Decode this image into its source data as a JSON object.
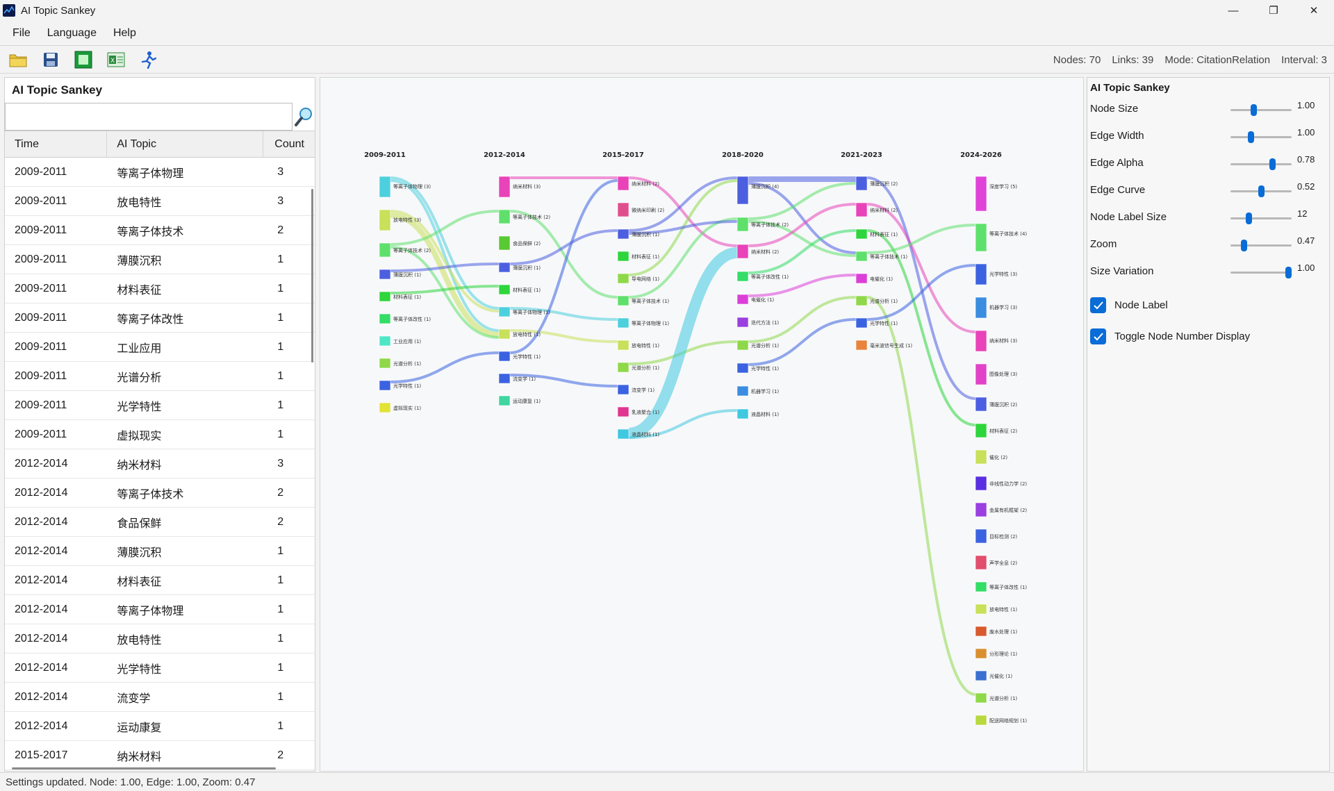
{
  "window": {
    "title": "AI Topic Sankey"
  },
  "menu": [
    "File",
    "Language",
    "Help"
  ],
  "toolbar": {
    "icons": [
      "open-folder-icon",
      "save-icon",
      "export-image-icon",
      "export-excel-icon",
      "run-icon"
    ]
  },
  "status": {
    "nodes": "Nodes: 70",
    "links": "Links: 39",
    "mode": "Mode: CitationRelation",
    "interval": "Interval: 3"
  },
  "left_panel": {
    "title": "AI Topic Sankey",
    "search_value": "",
    "headers": [
      "Time",
      "AI Topic",
      "Count"
    ],
    "rows": [
      [
        "2009-2011",
        "等离子体物理",
        "3"
      ],
      [
        "2009-2011",
        "放电特性",
        "3"
      ],
      [
        "2009-2011",
        "等离子体技术",
        "2"
      ],
      [
        "2009-2011",
        "薄膜沉积",
        "1"
      ],
      [
        "2009-2011",
        "材料表征",
        "1"
      ],
      [
        "2009-2011",
        "等离子体改性",
        "1"
      ],
      [
        "2009-2011",
        "工业应用",
        "1"
      ],
      [
        "2009-2011",
        "光谱分析",
        "1"
      ],
      [
        "2009-2011",
        "光学特性",
        "1"
      ],
      [
        "2009-2011",
        "虚拟现实",
        "1"
      ],
      [
        "2012-2014",
        "纳米材料",
        "3"
      ],
      [
        "2012-2014",
        "等离子体技术",
        "2"
      ],
      [
        "2012-2014",
        "食品保鲜",
        "2"
      ],
      [
        "2012-2014",
        "薄膜沉积",
        "1"
      ],
      [
        "2012-2014",
        "材料表征",
        "1"
      ],
      [
        "2012-2014",
        "等离子体物理",
        "1"
      ],
      [
        "2012-2014",
        "放电特性",
        "1"
      ],
      [
        "2012-2014",
        "光学特性",
        "1"
      ],
      [
        "2012-2014",
        "流变学",
        "1"
      ],
      [
        "2012-2014",
        "运动康复",
        "1"
      ],
      [
        "2015-2017",
        "纳米材料",
        "2"
      ]
    ]
  },
  "right_panel": {
    "title": "AI Topic Sankey",
    "sliders": [
      {
        "label": "Node Size",
        "value": "1.00",
        "pos": 0.38
      },
      {
        "label": "Edge Width",
        "value": "1.00",
        "pos": 0.33
      },
      {
        "label": "Edge Alpha",
        "value": "0.78",
        "pos": 0.68
      },
      {
        "label": "Edge Curve",
        "value": "0.52",
        "pos": 0.5
      },
      {
        "label": "Node Label Size",
        "value": "12",
        "pos": 0.3
      },
      {
        "label": "Zoom",
        "value": "0.47",
        "pos": 0.22
      },
      {
        "label": "Size Variation",
        "value": "1.00",
        "pos": 0.94
      }
    ],
    "checks": [
      {
        "label": "Node Label",
        "checked": true
      },
      {
        "label": "Toggle Node Number Display",
        "checked": true
      }
    ]
  },
  "sankey": {
    "periods": [
      "2009-2011",
      "2012-2014",
      "2015-2017",
      "2018-2020",
      "2021-2023",
      "2024-2026"
    ],
    "columns": [
      [
        {
          "label": "等离子体物理 (3)",
          "color": "#4dd0dd",
          "n": 3
        },
        {
          "label": "放电特性 (3)",
          "color": "#c8e05a",
          "n": 3
        },
        {
          "label": "等离子体技术 (2)",
          "color": "#5fe06c",
          "n": 2
        },
        {
          "label": "薄膜沉积 (1)",
          "color": "#4c5fe0",
          "n": 1
        },
        {
          "label": "材料表征 (1)",
          "color": "#2ed53c",
          "n": 1
        },
        {
          "label": "等离子体改性 (1)",
          "color": "#33dd66",
          "n": 1
        },
        {
          "label": "工业应用 (1)",
          "color": "#4fe6c6",
          "n": 1
        },
        {
          "label": "光谱分析 (1)",
          "color": "#8fd84a",
          "n": 1
        },
        {
          "label": "光学特性 (1)",
          "color": "#3b62e0",
          "n": 1
        },
        {
          "label": "虚拟现实 (1)",
          "color": "#e2e237",
          "n": 1
        }
      ],
      [
        {
          "label": "纳米材料 (3)",
          "color": "#e843b8",
          "n": 3
        },
        {
          "label": "等离子体技术 (2)",
          "color": "#5fe06c",
          "n": 2
        },
        {
          "label": "食品保鲜 (2)",
          "color": "#59c932",
          "n": 2
        },
        {
          "label": "薄膜沉积 (1)",
          "color": "#4c5fe0",
          "n": 1
        },
        {
          "label": "材料表征 (1)",
          "color": "#2ed53c",
          "n": 1
        },
        {
          "label": "等离子体物理 (1)",
          "color": "#4dd0dd",
          "n": 1
        },
        {
          "label": "放电特性 (1)",
          "color": "#c8e05a",
          "n": 1
        },
        {
          "label": "光学特性 (1)",
          "color": "#3b62e0",
          "n": 1
        },
        {
          "label": "流变学 (1)",
          "color": "#3b62e0",
          "n": 1
        },
        {
          "label": "运动康复 (1)",
          "color": "#3fd6a0",
          "n": 1
        }
      ],
      [
        {
          "label": "纳米材料 (2)",
          "color": "#e843b8",
          "n": 2
        },
        {
          "label": "微纳米印刷 (2)",
          "color": "#e04f8d",
          "n": 2
        },
        {
          "label": "薄膜沉积 (1)",
          "color": "#4c5fe0",
          "n": 1
        },
        {
          "label": "材料表征 (1)",
          "color": "#2ed53c",
          "n": 1
        },
        {
          "label": "导电网络 (1)",
          "color": "#8fd84a",
          "n": 1
        },
        {
          "label": "等离子体技术 (1)",
          "color": "#5fe06c",
          "n": 1
        },
        {
          "label": "等离子体物理 (1)",
          "color": "#4dd0dd",
          "n": 1
        },
        {
          "label": "放电特性 (1)",
          "color": "#c8e05a",
          "n": 1
        },
        {
          "label": "光谱分析 (1)",
          "color": "#8fd84a",
          "n": 1
        },
        {
          "label": "流变学 (1)",
          "color": "#3b62e0",
          "n": 1
        },
        {
          "label": "乳液聚合 (1)",
          "color": "#e0368f",
          "n": 1
        },
        {
          "label": "液晶材料 (1)",
          "color": "#3fc8e0",
          "n": 1
        }
      ],
      [
        {
          "label": "薄膜沉积 (4)",
          "color": "#4c5fe0",
          "n": 4
        },
        {
          "label": "等离子体技术 (2)",
          "color": "#5fe06c",
          "n": 2
        },
        {
          "label": "纳米材料 (2)",
          "color": "#e843b8",
          "n": 2
        },
        {
          "label": "等离子体改性 (1)",
          "color": "#33dd66",
          "n": 1
        },
        {
          "label": "电催化 (1)",
          "color": "#dc3fd8",
          "n": 1
        },
        {
          "label": "迭代方法 (1)",
          "color": "#9a3fe0",
          "n": 1
        },
        {
          "label": "光谱分析 (1)",
          "color": "#8fd84a",
          "n": 1
        },
        {
          "label": "光学特性 (1)",
          "color": "#3b62e0",
          "n": 1
        },
        {
          "label": "机器学习 (1)",
          "color": "#3b8de0",
          "n": 1
        },
        {
          "label": "液晶材料 (1)",
          "color": "#3fc8e0",
          "n": 1
        }
      ],
      [
        {
          "label": "薄膜沉积 (2)",
          "color": "#4c5fe0",
          "n": 2
        },
        {
          "label": "纳米材料 (2)",
          "color": "#e843b8",
          "n": 2
        },
        {
          "label": "材料表征 (1)",
          "color": "#2ed53c",
          "n": 1
        },
        {
          "label": "等离子体技术 (1)",
          "color": "#5fe06c",
          "n": 1
        },
        {
          "label": "电催化 (1)",
          "color": "#dc3fd8",
          "n": 1
        },
        {
          "label": "光谱分析 (1)",
          "color": "#8fd84a",
          "n": 1
        },
        {
          "label": "光学特性 (1)",
          "color": "#3b62e0",
          "n": 1
        },
        {
          "label": "毫米波信号生成 (1)",
          "color": "#e8843c",
          "n": 1
        }
      ],
      [
        {
          "label": "深度学习 (5)",
          "color": "#e043d8",
          "n": 5
        },
        {
          "label": "等离子体技术 (4)",
          "color": "#5fe06c",
          "n": 4
        },
        {
          "label": "光学特性 (3)",
          "color": "#3b62e0",
          "n": 3
        },
        {
          "label": "机器学习 (3)",
          "color": "#3b8de0",
          "n": 3
        },
        {
          "label": "纳米材料 (3)",
          "color": "#e843b8",
          "n": 3
        },
        {
          "label": "图像处理 (3)",
          "color": "#e043c8",
          "n": 3
        },
        {
          "label": "薄膜沉积 (2)",
          "color": "#4c5fe0",
          "n": 2
        },
        {
          "label": "材料表征 (2)",
          "color": "#2ed53c",
          "n": 2
        },
        {
          "label": "催化 (2)",
          "color": "#c8e05a",
          "n": 2
        },
        {
          "label": "非线性动力学 (2)",
          "color": "#5a2fe0",
          "n": 2
        },
        {
          "label": "金属有机框架 (2)",
          "color": "#9a3fe0",
          "n": 2
        },
        {
          "label": "目标检测 (2)",
          "color": "#3b62e0",
          "n": 2
        },
        {
          "label": "声学全息 (2)",
          "color": "#e04f6d",
          "n": 2
        },
        {
          "label": "等离子体改性 (1)",
          "color": "#33dd66",
          "n": 1
        },
        {
          "label": "放电特性 (1)",
          "color": "#c8e05a",
          "n": 1
        },
        {
          "label": "废水处理 (1)",
          "color": "#d85a2f",
          "n": 1
        },
        {
          "label": "分形理论 (1)",
          "color": "#d88f2f",
          "n": 1
        },
        {
          "label": "光催化 (1)",
          "color": "#3b6fd0",
          "n": 1
        },
        {
          "label": "光谱分析 (1)",
          "color": "#8fd84a",
          "n": 1
        },
        {
          "label": "配送网络规划 (1)",
          "color": "#b8d83f",
          "n": 1
        }
      ]
    ],
    "links": [
      {
        "s": [
          0,
          0
        ],
        "t": [
          1,
          5
        ],
        "v": 1,
        "color": "#4dd0dd"
      },
      {
        "s": [
          0,
          0
        ],
        "t": [
          1,
          6
        ],
        "v": 1,
        "color": "#4dd0dd"
      },
      {
        "s": [
          0,
          1
        ],
        "t": [
          1,
          5
        ],
        "v": 1,
        "color": "#c8e05a"
      },
      {
        "s": [
          0,
          1
        ],
        "t": [
          1,
          6
        ],
        "v": 2,
        "color": "#c8e05a"
      },
      {
        "s": [
          0,
          2
        ],
        "t": [
          1,
          1
        ],
        "v": 1,
        "color": "#5fe06c"
      },
      {
        "s": [
          0,
          2
        ],
        "t": [
          1,
          6
        ],
        "v": 1,
        "color": "#5fe06c"
      },
      {
        "s": [
          0,
          3
        ],
        "t": [
          1,
          3
        ],
        "v": 1,
        "color": "#4c5fe0"
      },
      {
        "s": [
          0,
          4
        ],
        "t": [
          1,
          4
        ],
        "v": 1,
        "color": "#2ed53c"
      },
      {
        "s": [
          0,
          8
        ],
        "t": [
          1,
          7
        ],
        "v": 1,
        "color": "#3b62e0"
      },
      {
        "s": [
          1,
          0
        ],
        "t": [
          2,
          0
        ],
        "v": 1,
        "color": "#e843b8"
      },
      {
        "s": [
          1,
          1
        ],
        "t": [
          2,
          5
        ],
        "v": 1,
        "color": "#5fe06c"
      },
      {
        "s": [
          1,
          3
        ],
        "t": [
          2,
          2
        ],
        "v": 1,
        "color": "#4c5fe0"
      },
      {
        "s": [
          1,
          5
        ],
        "t": [
          2,
          6
        ],
        "v": 1,
        "color": "#4dd0dd"
      },
      {
        "s": [
          1,
          6
        ],
        "t": [
          2,
          7
        ],
        "v": 1,
        "color": "#c8e05a"
      },
      {
        "s": [
          1,
          7
        ],
        "t": [
          2,
          0
        ],
        "v": 1,
        "color": "#3b62e0"
      },
      {
        "s": [
          1,
          8
        ],
        "t": [
          2,
          9
        ],
        "v": 1,
        "color": "#3b62e0"
      },
      {
        "s": [
          2,
          0
        ],
        "t": [
          3,
          2
        ],
        "v": 1,
        "color": "#e843b8"
      },
      {
        "s": [
          2,
          2
        ],
        "t": [
          3,
          0
        ],
        "v": 1,
        "color": "#4c5fe0"
      },
      {
        "s": [
          2,
          4
        ],
        "t": [
          3,
          0
        ],
        "v": 1,
        "color": "#8fd84a"
      },
      {
        "s": [
          2,
          5
        ],
        "t": [
          3,
          1
        ],
        "v": 1,
        "color": "#5fe06c"
      },
      {
        "s": [
          2,
          2
        ],
        "t": [
          3,
          1
        ],
        "v": 1,
        "color": "#4c5fe0"
      },
      {
        "s": [
          2,
          8
        ],
        "t": [
          3,
          6
        ],
        "v": 1,
        "color": "#8fd84a"
      },
      {
        "s": [
          2,
          11
        ],
        "t": [
          3,
          2
        ],
        "v": 4,
        "color": "#3fc8e0"
      },
      {
        "s": [
          2,
          11
        ],
        "t": [
          3,
          9
        ],
        "v": 1,
        "color": "#3fc8e0"
      },
      {
        "s": [
          3,
          0
        ],
        "t": [
          4,
          0
        ],
        "v": 2,
        "color": "#4c5fe0"
      },
      {
        "s": [
          3,
          0
        ],
        "t": [
          4,
          3
        ],
        "v": 1,
        "color": "#4c5fe0"
      },
      {
        "s": [
          3,
          1
        ],
        "t": [
          4,
          0
        ],
        "v": 1,
        "color": "#5fe06c"
      },
      {
        "s": [
          3,
          1
        ],
        "t": [
          4,
          3
        ],
        "v": 1,
        "color": "#5fe06c"
      },
      {
        "s": [
          3,
          2
        ],
        "t": [
          4,
          1
        ],
        "v": 1,
        "color": "#e843b8"
      },
      {
        "s": [
          3,
          3
        ],
        "t": [
          4,
          2
        ],
        "v": 1,
        "color": "#33dd66"
      },
      {
        "s": [
          3,
          4
        ],
        "t": [
          4,
          4
        ],
        "v": 1,
        "color": "#dc3fd8"
      },
      {
        "s": [
          3,
          6
        ],
        "t": [
          4,
          5
        ],
        "v": 1,
        "color": "#8fd84a"
      },
      {
        "s": [
          3,
          7
        ],
        "t": [
          4,
          6
        ],
        "v": 1,
        "color": "#3b62e0"
      },
      {
        "s": [
          4,
          0
        ],
        "t": [
          5,
          6
        ],
        "v": 1,
        "color": "#4c5fe0"
      },
      {
        "s": [
          4,
          1
        ],
        "t": [
          5,
          4
        ],
        "v": 1,
        "color": "#e843b8"
      },
      {
        "s": [
          4,
          2
        ],
        "t": [
          5,
          7
        ],
        "v": 1,
        "color": "#2ed53c"
      },
      {
        "s": [
          4,
          3
        ],
        "t": [
          5,
          1
        ],
        "v": 1,
        "color": "#5fe06c"
      },
      {
        "s": [
          4,
          5
        ],
        "t": [
          5,
          18
        ],
        "v": 1,
        "color": "#8fd84a"
      },
      {
        "s": [
          4,
          6
        ],
        "t": [
          5,
          2
        ],
        "v": 1,
        "color": "#3b62e0"
      }
    ]
  },
  "statusbar": {
    "text": "Settings updated. Node: 1.00, Edge: 1.00, Zoom: 0.47"
  }
}
